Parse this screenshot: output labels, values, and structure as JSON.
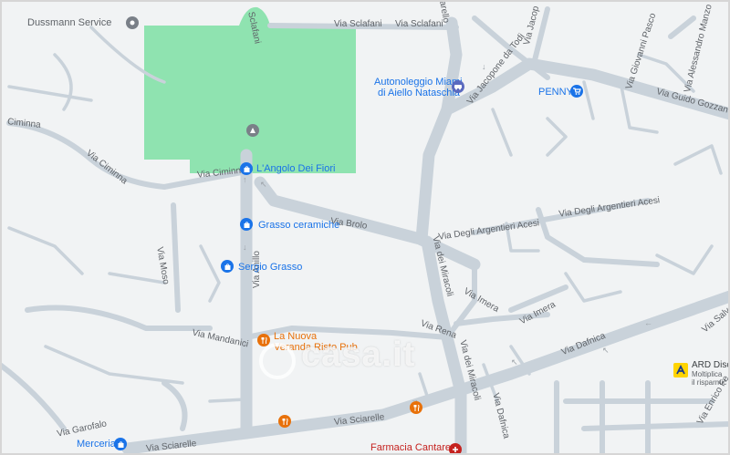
{
  "map": {
    "streets": {
      "sclafani_1": "Via Sclafani",
      "sclafani_2": "Via Sclafani",
      "ciminna_1": "Ciminna",
      "ciminna_2": "Via Ciminna",
      "ciminna_3": "Via Ciminna",
      "moso": "Via Moso",
      "mandanici": "Via Mandanici",
      "anillo": "Via Anillo",
      "brolo": "Via Brolo",
      "miracoli_1": "Via dei Miracoli",
      "miracoli_2": "Via dei Miracoli",
      "argentieri_1": "Via Degli Argentieri Acesi",
      "argentieri_2": "Via Degli Argentieri Acesi",
      "imera_1": "Via Imera",
      "imera_2": "Via Imera",
      "rena": "Via Rena",
      "dafnica_1": "Via Dafnica",
      "dafnica_2": "Via Dafnica",
      "garofalo": "Via Garofalo",
      "sciarelle_1": "Via Sciarelle",
      "sciarelle_2": "Via Sciarelle",
      "jacopone": "Via Jacopone da Todi",
      "jacopo_top": "Via Jacop",
      "giovanni": "Via Giovanni Pasco",
      "alessandro": "Via Alessandro Manzo",
      "gozzano": "Via Guido Gozzano",
      "salva": "Via Salva",
      "enrico": "Via Enrico Fe",
      "sclafani_rot": "Via Sclafani",
      "sclafani_rot2": "Sclafani",
      "arello": "arello"
    },
    "pois": {
      "dussmann": "Dussmann Service",
      "autonoleggio_1": "Autonoleggio Miami",
      "autonoleggio_2": "di Aiello Nataschia",
      "penny": "PENNY",
      "angolo": "L'Angolo Dei Fiori",
      "grasso_ceramiche": "Grasso ceramiche",
      "sergio_grasso": "Sergio Grasso",
      "la_nuova_1": "La Nuova",
      "la_nuova_2": "Veranda Risto Pub",
      "merceria": "Merceria",
      "farmacia": "Farmacia Cantarero",
      "ard_1": "ARD Disc",
      "ard_2": "Moltiplica",
      "ard_3": "il risparmic"
    },
    "watermark": "casa.it",
    "colors": {
      "background": "#f1f3f4",
      "road": "#c9d2da",
      "road_outline": "#b9c3cc",
      "park": "#8fe3b0",
      "poi_blue": "#1a73e8",
      "poi_orange": "#e8710a",
      "poi_red": "#c5221f"
    },
    "icons": {
      "dussmann": "place-pin-icon",
      "autonoleggio": "car-rental-icon",
      "penny": "shopping-cart-icon",
      "shop": "shopping-bag-icon",
      "restaurant": "fork-knife-icon",
      "park_pin": "park-monument-icon",
      "fuel": "fuel-station-icon"
    }
  }
}
